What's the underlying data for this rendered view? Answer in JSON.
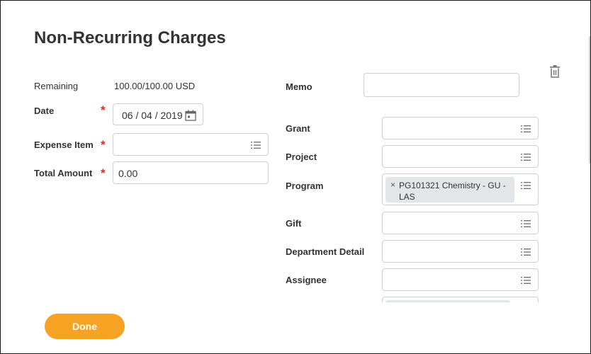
{
  "page": {
    "title": "Non-Recurring Charges"
  },
  "left": {
    "remaining": {
      "label": "Remaining",
      "value": "100.00/100.00 USD"
    },
    "date": {
      "label": "Date",
      "required": "*",
      "value": "06 / 04 / 2019",
      "icon": "calendar-icon"
    },
    "expense_item": {
      "label": "Expense Item",
      "required": "*",
      "value": "",
      "icon": "list-icon"
    },
    "total_amount": {
      "label": "Total Amount",
      "required": "*",
      "value": "0.00"
    }
  },
  "right": {
    "memo": {
      "label": "Memo",
      "value": ""
    },
    "grant": {
      "label": "Grant",
      "value": ""
    },
    "project": {
      "label": "Project",
      "value": ""
    },
    "program": {
      "label": "Program",
      "remove": "×",
      "tag": "PG101321 Chemistry - GU - LAS"
    },
    "gift": {
      "label": "Gift",
      "value": ""
    },
    "department_detail": {
      "label": "Department Detail",
      "value": ""
    },
    "assignee": {
      "label": "Assignee",
      "value": ""
    }
  },
  "actions": {
    "done_label": "Done",
    "delete_icon": "trash-icon"
  },
  "colors": {
    "accent": "#f6a323",
    "required": "#de2b2b",
    "tag_bg": "#e3e6e8",
    "border": "#ced0d2"
  }
}
